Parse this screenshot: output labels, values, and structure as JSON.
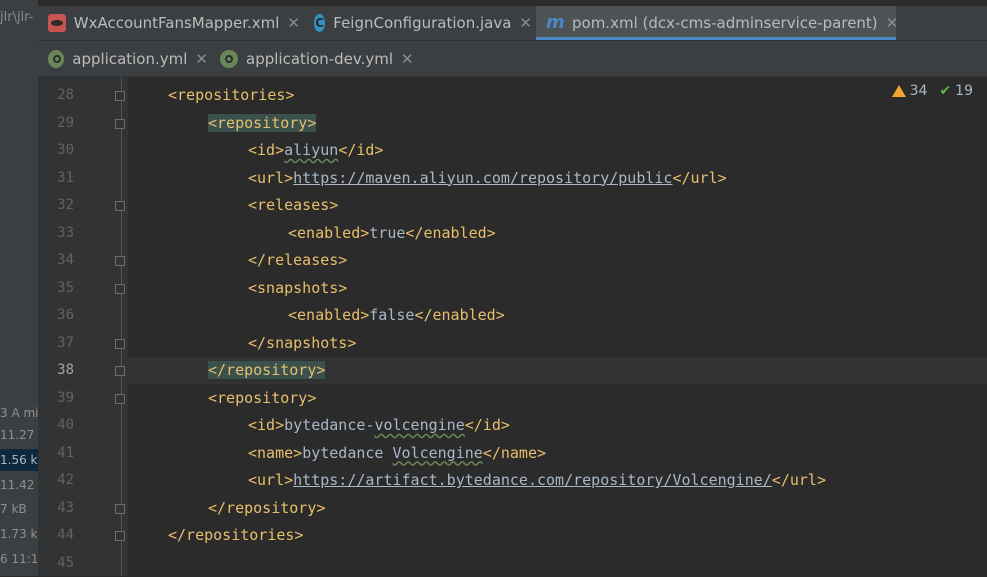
{
  "left_panel": {
    "top_text": "jlr\\jlr-",
    "items": [
      {
        "label": "3 A mi",
        "selected": false
      },
      {
        "label": "11.27",
        "selected": false
      },
      {
        "label": "1.56 k",
        "selected": true
      },
      {
        "label": "11.42",
        "selected": false
      },
      {
        "label": "7 kB",
        "selected": false
      },
      {
        "label": "1.73 kl",
        "selected": false
      },
      {
        "label": "6 11:1",
        "selected": false
      }
    ]
  },
  "tabs_row1": [
    {
      "label": "WxAccountFansMapper.xml",
      "icon": "xml-icon",
      "active": false
    },
    {
      "label": "FeignConfiguration.java",
      "icon": "class-icon",
      "active": false
    },
    {
      "label": "pom.xml (dcx-cms-adminservice-parent)",
      "icon": "maven-icon",
      "active": true
    }
  ],
  "tabs_row2": [
    {
      "label": "application.yml",
      "icon": "spring-yml-icon",
      "active": false
    },
    {
      "label": "application-dev.yml",
      "icon": "spring-yml-icon",
      "active": false
    }
  ],
  "inspections": {
    "warnings": "34",
    "passed": "19"
  },
  "current_line": 38,
  "lines": [
    {
      "n": "28",
      "indent": 1,
      "tokens": [
        [
          "t",
          "<repositories>"
        ]
      ]
    },
    {
      "n": "29",
      "indent": 2,
      "tokens": [
        [
          "th",
          "<repository>"
        ]
      ]
    },
    {
      "n": "30",
      "indent": 3,
      "tokens": [
        [
          "t",
          "<id>"
        ],
        [
          "w",
          "aliyun"
        ],
        [
          "t",
          "</id>"
        ]
      ]
    },
    {
      "n": "31",
      "indent": 3,
      "tokens": [
        [
          "t",
          "<url>"
        ],
        [
          "u",
          "https://maven.aliyun.com/repository/public"
        ],
        [
          "t",
          "</url>"
        ]
      ]
    },
    {
      "n": "32",
      "indent": 3,
      "tokens": [
        [
          "t",
          "<releases>"
        ]
      ]
    },
    {
      "n": "33",
      "indent": 4,
      "tokens": [
        [
          "t",
          "<enabled>"
        ],
        [
          "v",
          "true"
        ],
        [
          "t",
          "</enabled>"
        ]
      ]
    },
    {
      "n": "34",
      "indent": 3,
      "tokens": [
        [
          "t",
          "</releases>"
        ]
      ]
    },
    {
      "n": "35",
      "indent": 3,
      "tokens": [
        [
          "t",
          "<snapshots>"
        ]
      ]
    },
    {
      "n": "36",
      "indent": 4,
      "tokens": [
        [
          "t",
          "<enabled>"
        ],
        [
          "v",
          "false"
        ],
        [
          "t",
          "</enabled>"
        ]
      ]
    },
    {
      "n": "37",
      "indent": 3,
      "tokens": [
        [
          "t",
          "</snapshots>"
        ]
      ]
    },
    {
      "n": "38",
      "indent": 2,
      "tokens": [
        [
          "th",
          "</repository>"
        ]
      ]
    },
    {
      "n": "39",
      "indent": 2,
      "tokens": [
        [
          "t",
          "<repository>"
        ]
      ]
    },
    {
      "n": "40",
      "indent": 3,
      "tokens": [
        [
          "t",
          "<id>"
        ],
        [
          "v",
          "bytedance-"
        ],
        [
          "w",
          "volcengine"
        ],
        [
          "t",
          "</id>"
        ]
      ]
    },
    {
      "n": "41",
      "indent": 3,
      "tokens": [
        [
          "t",
          "<name>"
        ],
        [
          "v",
          "bytedance "
        ],
        [
          "w",
          "Volcengine"
        ],
        [
          "t",
          "</name>"
        ]
      ]
    },
    {
      "n": "42",
      "indent": 3,
      "tokens": [
        [
          "t",
          "<url>"
        ],
        [
          "u",
          "https://artifact.bytedance.com/repository/Volcengine/"
        ],
        [
          "t",
          "</url>"
        ]
      ]
    },
    {
      "n": "43",
      "indent": 2,
      "tokens": [
        [
          "t",
          "</repository>"
        ]
      ]
    },
    {
      "n": "44",
      "indent": 1,
      "tokens": [
        [
          "t",
          "</repositories>"
        ]
      ]
    },
    {
      "n": "45",
      "indent": 0,
      "tokens": []
    }
  ]
}
